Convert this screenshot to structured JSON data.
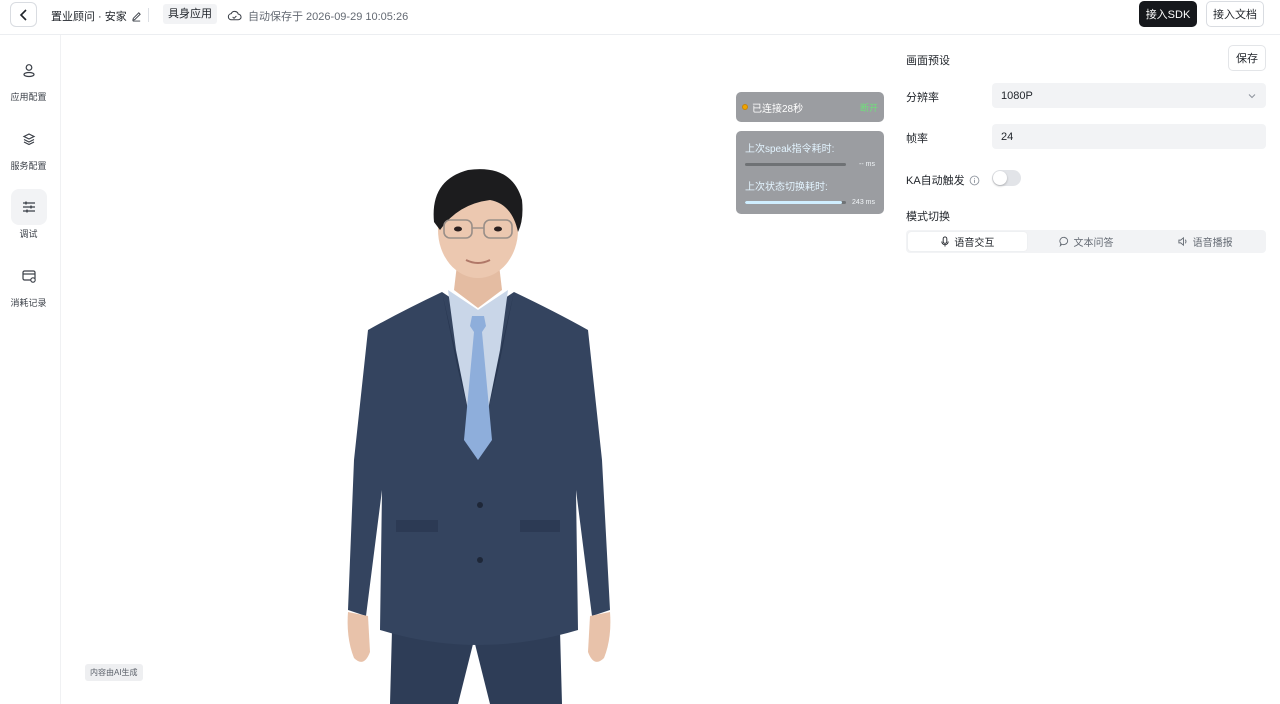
{
  "header": {
    "app_name": "置业顾问 · 安家",
    "app_type": "具身应用",
    "autosave_text": "自动保存于 2026-09-29 10:05:26",
    "sdk_button": "接入SDK",
    "docs_button": "接入文档"
  },
  "sidebar": {
    "items": [
      {
        "label": "应用配置",
        "icon": "user-icon"
      },
      {
        "label": "服务配置",
        "icon": "layers-icon"
      },
      {
        "label": "调试",
        "icon": "sliders-icon",
        "active": true
      },
      {
        "label": "消耗记录",
        "icon": "billing-icon"
      }
    ]
  },
  "stage": {
    "ai_badge": "内容由AI生成",
    "connection": {
      "status": "已连接28秒",
      "disconnect": "断开",
      "status_color": "#f0a500"
    },
    "metrics": [
      {
        "label": "上次speak指令耗时:",
        "value": "-- ms",
        "fill": 0
      },
      {
        "label": "上次状态切换耗时:",
        "value": "243 ms",
        "fill": 0.96
      }
    ]
  },
  "panel": {
    "title": "画面预设",
    "save_button": "保存",
    "resolution": {
      "label": "分辨率",
      "value": "1080P"
    },
    "framerate": {
      "label": "帧率",
      "value": "24"
    },
    "ka_trigger": {
      "label": "KA自动触发",
      "enabled": false
    },
    "mode": {
      "label": "模式切换",
      "options": [
        "语音交互",
        "文本问答",
        "语音播报"
      ],
      "selected": "语音交互"
    }
  }
}
